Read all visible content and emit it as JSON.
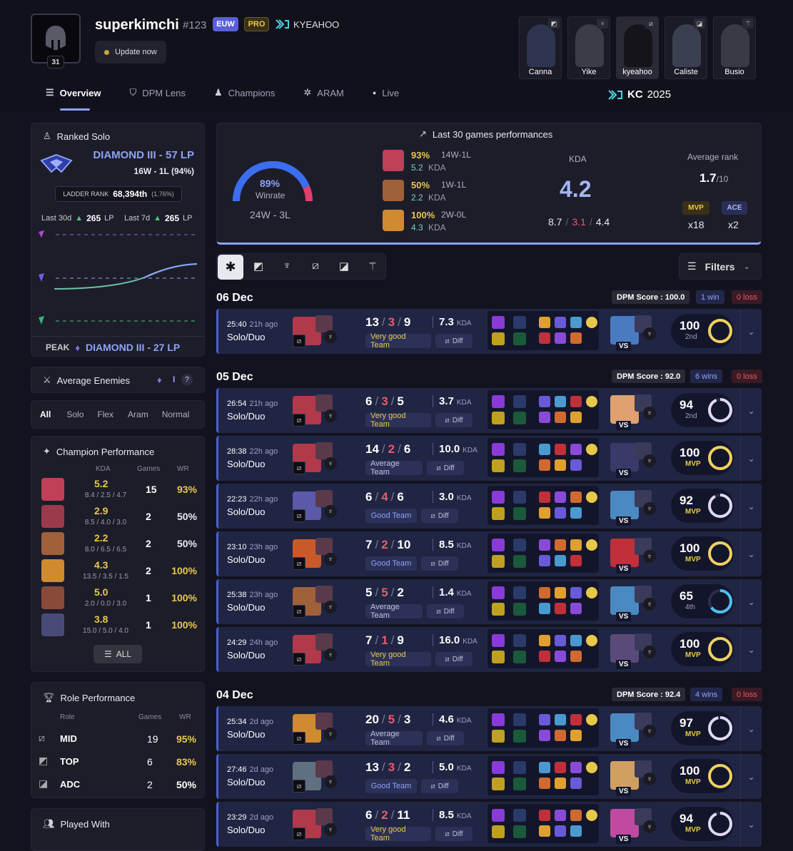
{
  "profile": {
    "name": "superkimchi",
    "tag": "#123",
    "region": "EUW",
    "pro_badge": "PRO",
    "team": "KYEAHOO",
    "level": "31",
    "update_label": "Update now"
  },
  "teammates": [
    {
      "name": "Canna",
      "role_icon": "top-role-icon"
    },
    {
      "name": "Yike",
      "role_icon": "jungle-role-icon"
    },
    {
      "name": "kyeahoo",
      "role_icon": "mid-role-icon"
    },
    {
      "name": "Caliste",
      "role_icon": "bot-role-icon"
    },
    {
      "name": "Busio",
      "role_icon": "support-role-icon"
    }
  ],
  "tabs": [
    {
      "label": "Overview",
      "icon": "overview-icon",
      "active": true
    },
    {
      "label": "DPM Lens",
      "icon": "dpm-lens-icon"
    },
    {
      "label": "Champions",
      "icon": "champions-icon"
    },
    {
      "label": "ARAM",
      "icon": "aram-icon"
    },
    {
      "label": "Live",
      "icon": "live-dot-icon"
    }
  ],
  "event": {
    "prefix": "KC",
    "year": "2025"
  },
  "ranked": {
    "title": "Ranked Solo",
    "rank": "DIAMOND III - 57 LP",
    "record": "16W - 1L (94%)",
    "ladder_label": "LADDER RANK",
    "ladder_rank": "68,394th",
    "ladder_pct": "(1.76%)",
    "last30_label": "Last 30d",
    "last30_value": "265",
    "last7_label": "Last 7d",
    "last7_value": "265",
    "lp_unit": "LP",
    "peak_label": "PEAK",
    "peak_rank": "DIAMOND III - 27 LP"
  },
  "avg_enemies": {
    "title": "Average Enemies",
    "value": "I",
    "help": "?"
  },
  "queue_filters": [
    "All",
    "Solo",
    "Flex",
    "Aram",
    "Normal"
  ],
  "champ_perf": {
    "title": "Champion Performance",
    "headers": [
      "KDA",
      "Games",
      "WR"
    ],
    "rows": [
      {
        "kda": "5.2",
        "detail": "8.4 / 2.5 / 4.7",
        "games": "15",
        "wr": "93%"
      },
      {
        "kda": "2.9",
        "detail": "8.5 / 4.0 / 3.0",
        "games": "2",
        "wr": "50%"
      },
      {
        "kda": "2.2",
        "detail": "8.0 / 6.5 / 6.5",
        "games": "2",
        "wr": "50%"
      },
      {
        "kda": "4.3",
        "detail": "13.5 / 3.5 / 1.5",
        "games": "2",
        "wr": "100%"
      },
      {
        "kda": "5.0",
        "detail": "2.0 / 0.0 / 3.0",
        "games": "1",
        "wr": "100%"
      },
      {
        "kda": "3.8",
        "detail": "15.0 / 5.0 / 4.0",
        "games": "1",
        "wr": "100%"
      }
    ],
    "all_label": "ALL"
  },
  "role_perf": {
    "title": "Role Performance",
    "headers": [
      "Role",
      "Games",
      "WR"
    ],
    "rows": [
      {
        "role": "MID",
        "games": "19",
        "wr": "95%"
      },
      {
        "role": "TOP",
        "games": "6",
        "wr": "83%"
      },
      {
        "role": "ADC",
        "games": "2",
        "wr": "50%"
      }
    ]
  },
  "played_with": {
    "title": "Played With"
  },
  "last30": {
    "title": "Last 30 games performances",
    "winrate": "89%",
    "winrate_label": "Winrate",
    "record": "24W - 3L",
    "champs": [
      {
        "wr": "93%",
        "rec": "14W-1L",
        "kda": "5.2",
        "kda_label": "KDA"
      },
      {
        "wr": "50%",
        "rec": "1W-1L",
        "kda": "2.2",
        "kda_label": "KDA"
      },
      {
        "wr": "100%",
        "rec": "2W-0L",
        "kda": "4.3",
        "kda_label": "KDA"
      }
    ],
    "kda_label": "KDA",
    "kda": "4.2",
    "kills": "8.7",
    "deaths": "3.1",
    "assists": "4.4",
    "avg_rank_label": "Average rank",
    "avg_rank": "1.7",
    "avg_rank_of": "/10",
    "mvp_label": "MVP",
    "mvp_count": "x18",
    "ace_label": "ACE",
    "ace_count": "x2"
  },
  "filters_label": "Filters",
  "days": [
    {
      "date": "06 Dec",
      "dpm": "DPM Score : 100.0",
      "wins": "1 win",
      "losses": "0 loss"
    },
    {
      "date": "05 Dec",
      "dpm": "DPM Score : 92.0",
      "wins": "6 wins",
      "losses": "0 loss"
    },
    {
      "date": "04 Dec",
      "dpm": "DPM Score : 92.4",
      "wins": "4 wins",
      "losses": "0 loss"
    }
  ],
  "games": [
    {
      "time": "25:40",
      "ago": "21h ago",
      "queue": "Solo/Duo",
      "k": "13",
      "d": "3",
      "a": "9",
      "kda": "7.3",
      "team": "Very good Team",
      "diff": "Diff",
      "score": "100",
      "place": "2nd",
      "mvp": false,
      "pct": 100
    },
    {
      "time": "26:54",
      "ago": "21h ago",
      "queue": "Solo/Duo",
      "k": "6",
      "d": "3",
      "a": "5",
      "kda": "3.7",
      "team": "Very good Team",
      "diff": "Diff",
      "score": "94",
      "place": "2nd",
      "mvp": false,
      "pct": 94
    },
    {
      "time": "28:38",
      "ago": "22h ago",
      "queue": "Solo/Duo",
      "k": "14",
      "d": "2",
      "a": "6",
      "kda": "10.0",
      "team": "Average Team",
      "diff": "Diff",
      "score": "100",
      "place": "MVP",
      "mvp": true,
      "pct": 100
    },
    {
      "time": "22:23",
      "ago": "22h ago",
      "queue": "Solo/Duo",
      "k": "6",
      "d": "4",
      "a": "6",
      "kda": "3.0",
      "team": "Good Team",
      "diff": "Diff",
      "score": "92",
      "place": "MVP",
      "mvp": true,
      "pct": 92
    },
    {
      "time": "23:10",
      "ago": "23h ago",
      "queue": "Solo/Duo",
      "k": "7",
      "d": "2",
      "a": "10",
      "kda": "8.5",
      "team": "Good Team",
      "diff": "Diff",
      "score": "100",
      "place": "MVP",
      "mvp": true,
      "pct": 100
    },
    {
      "time": "25:38",
      "ago": "23h ago",
      "queue": "Solo/Duo",
      "k": "5",
      "d": "5",
      "a": "2",
      "kda": "1.4",
      "team": "Average Team",
      "diff": "Diff",
      "score": "65",
      "place": "4th",
      "mvp": false,
      "pct": 65
    },
    {
      "time": "24:29",
      "ago": "24h ago",
      "queue": "Solo/Duo",
      "k": "7",
      "d": "1",
      "a": "9",
      "kda": "16.0",
      "team": "Very good Team",
      "diff": "Diff",
      "score": "100",
      "place": "MVP",
      "mvp": true,
      "pct": 100
    },
    {
      "time": "25:34",
      "ago": "2d ago",
      "queue": "Solo/Duo",
      "k": "20",
      "d": "5",
      "a": "3",
      "kda": "4.6",
      "team": "Average Team",
      "diff": "Diff",
      "score": "97",
      "place": "MVP",
      "mvp": true,
      "pct": 97
    },
    {
      "time": "27:46",
      "ago": "2d ago",
      "queue": "Solo/Duo",
      "k": "13",
      "d": "3",
      "a": "2",
      "kda": "5.0",
      "team": "Good Team",
      "diff": "Diff",
      "score": "100",
      "place": "MVP",
      "mvp": true,
      "pct": 100
    },
    {
      "time": "23:29",
      "ago": "2d ago",
      "queue": "Solo/Duo",
      "k": "6",
      "d": "2",
      "a": "11",
      "kda": "8.5",
      "team": "Very good Team",
      "diff": "Diff",
      "score": "94",
      "place": "MVP",
      "mvp": true,
      "pct": 94
    }
  ],
  "kda_unit": "KDA",
  "vs_label": "VS"
}
